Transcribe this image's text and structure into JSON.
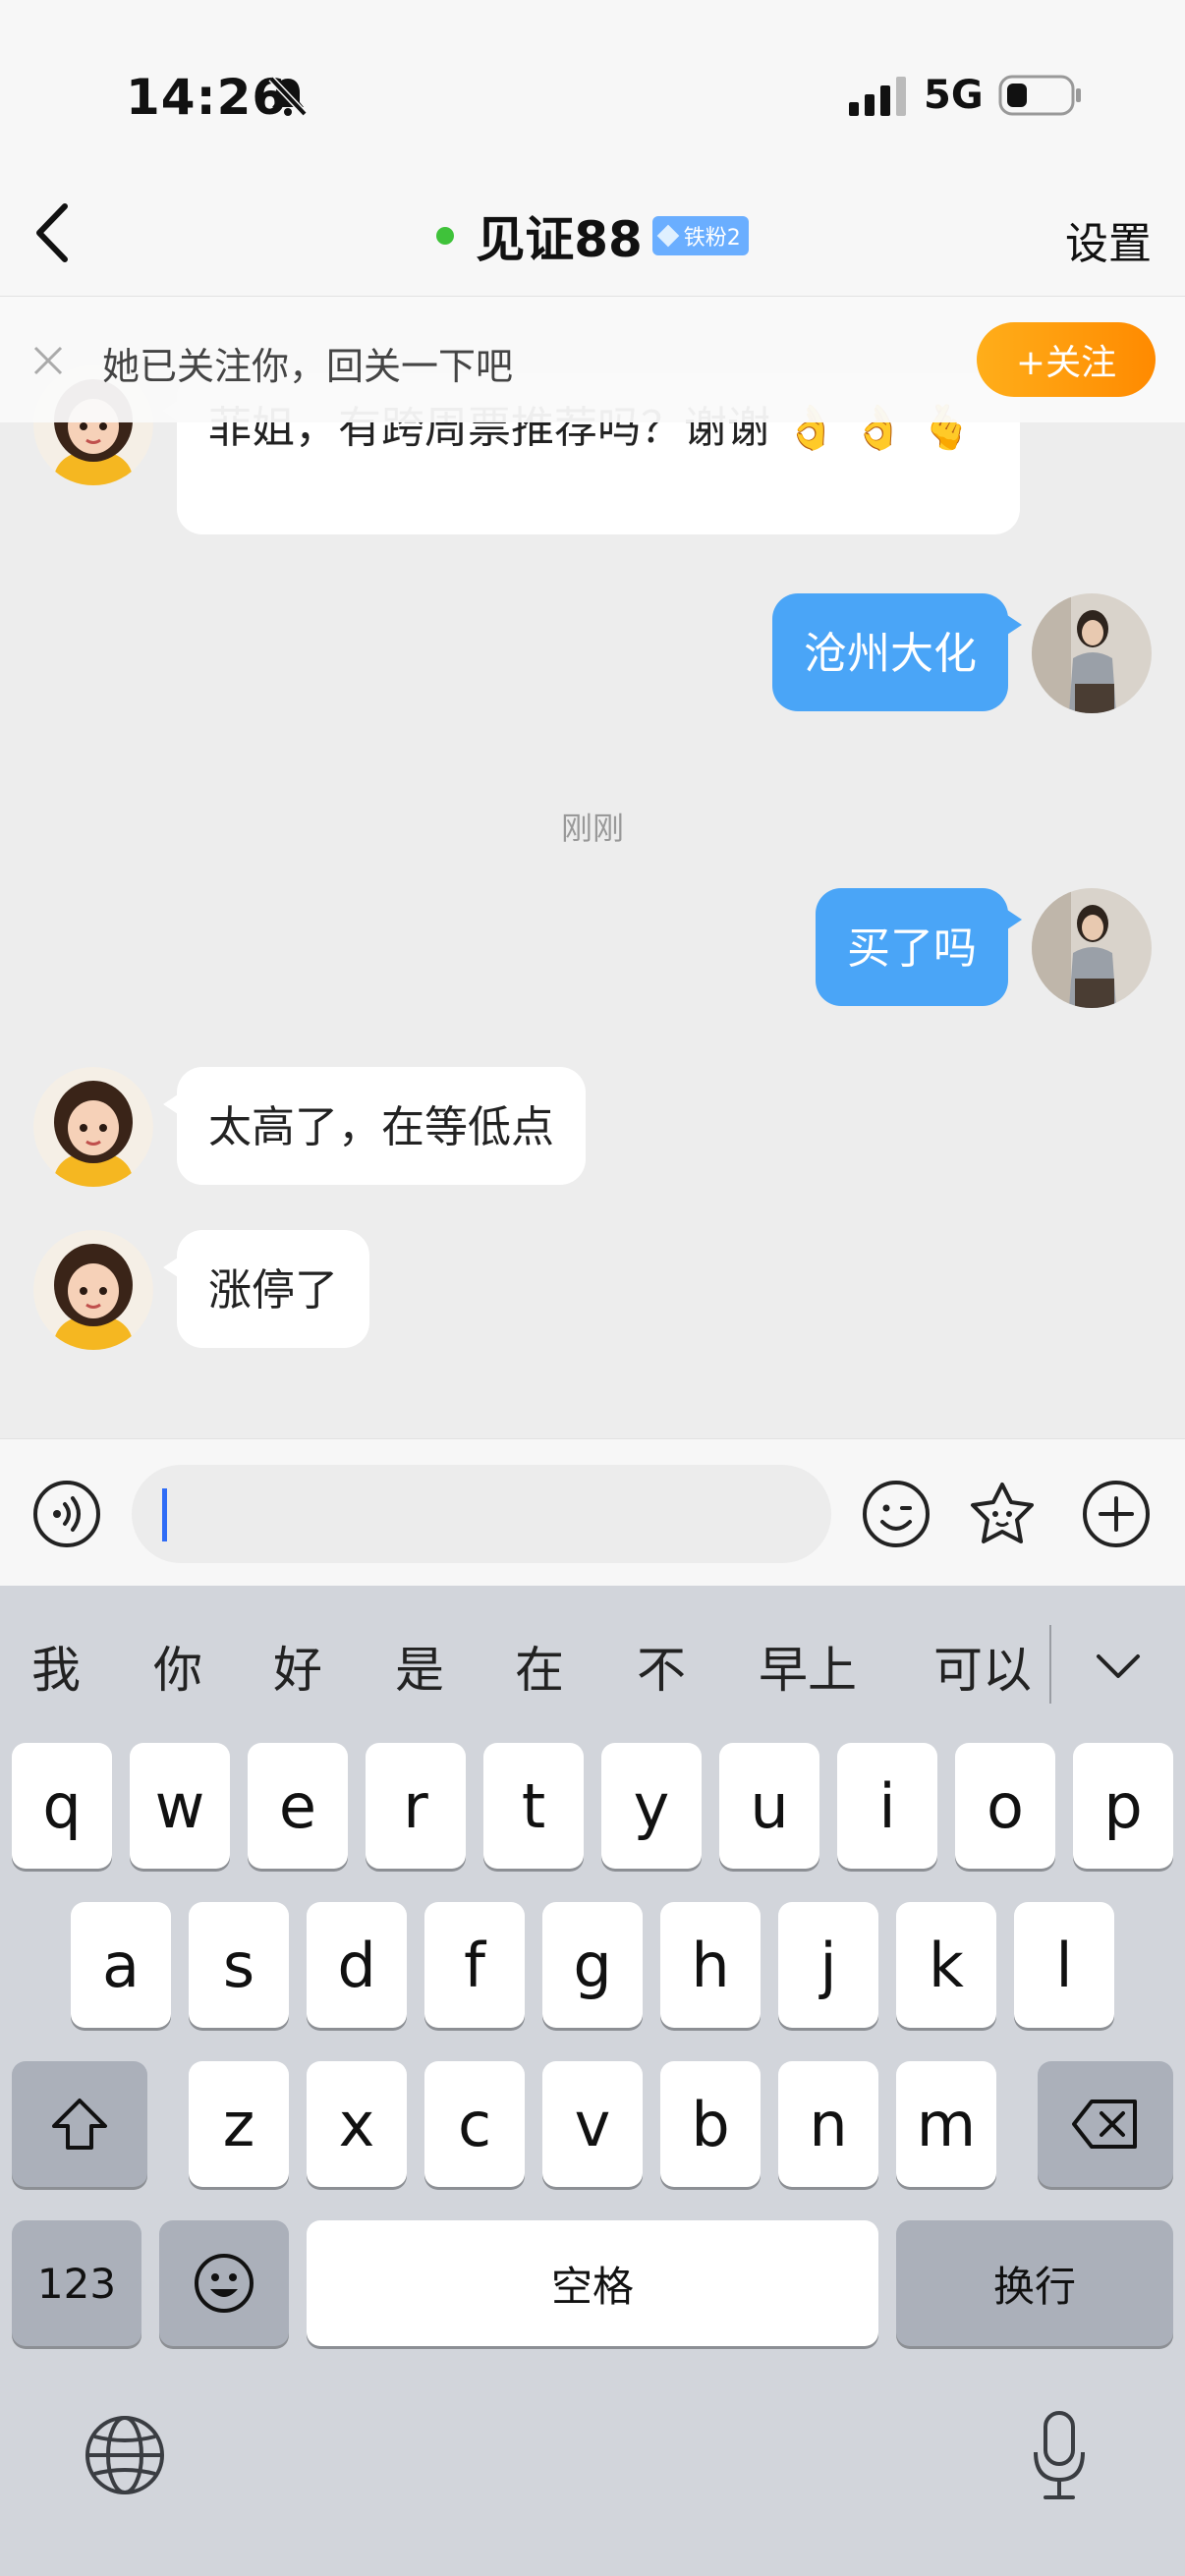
{
  "status_bar": {
    "time": "14:26",
    "network": "5G"
  },
  "header": {
    "title": "见证88",
    "badge": "铁粉2",
    "settings_label": "设置"
  },
  "follow_banner": {
    "text": "她已关注你，回关一下吧",
    "button_label": "+关注"
  },
  "messages": {
    "m1": {
      "sender": "them",
      "text": "菲姐，有跨周票推荐吗？谢谢 👌 👌 🫰"
    },
    "m2": {
      "sender": "me",
      "text": "沧州大化"
    },
    "time_divider": "刚刚",
    "m3": {
      "sender": "me",
      "text": "买了吗"
    },
    "m4": {
      "sender": "them",
      "text": "太高了，在等低点"
    },
    "m5": {
      "sender": "them",
      "text": "涨停了"
    }
  },
  "input": {
    "value": ""
  },
  "keyboard": {
    "candidates": [
      "我",
      "你",
      "好",
      "是",
      "在",
      "不",
      "早上",
      "可以"
    ],
    "row1": [
      "q",
      "w",
      "e",
      "r",
      "t",
      "y",
      "u",
      "i",
      "o",
      "p"
    ],
    "row2": [
      "a",
      "s",
      "d",
      "f",
      "g",
      "h",
      "j",
      "k",
      "l"
    ],
    "row3": [
      "z",
      "x",
      "c",
      "v",
      "b",
      "n",
      "m"
    ],
    "numbers_label": "123",
    "space_label": "空格",
    "return_label": "换行"
  },
  "colors": {
    "accent_blue": "#4aa5f7",
    "follow_orange": "#ff9500",
    "online_green": "#3fc23a"
  }
}
